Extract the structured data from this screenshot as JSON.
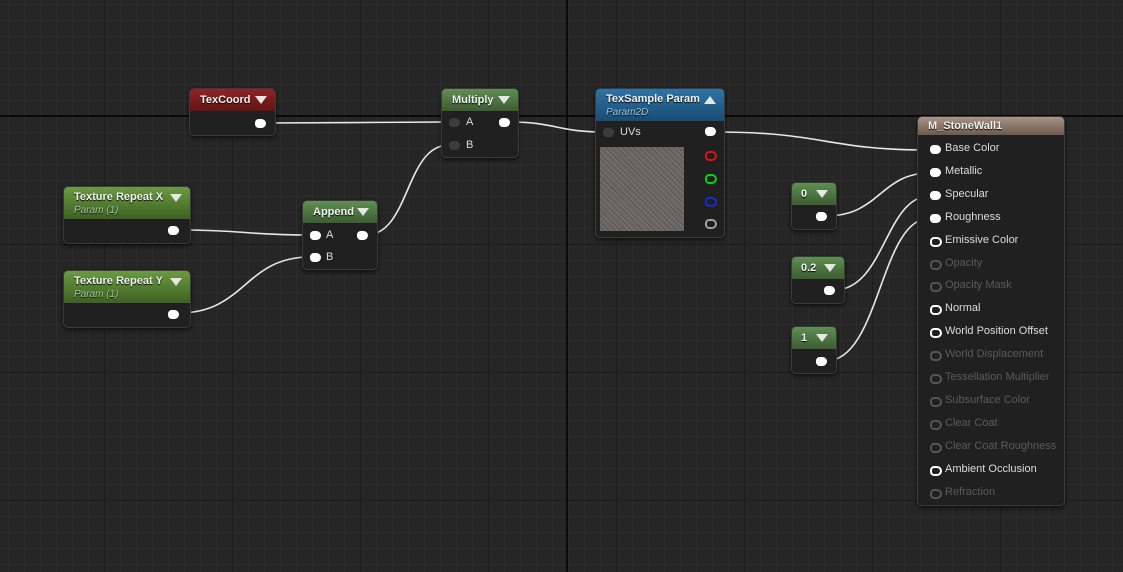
{
  "nodes": {
    "texcoord": {
      "title": "TexCoord"
    },
    "texture_repeat_x": {
      "title": "Texture Repeat X",
      "subtitle": "Param (1)"
    },
    "texture_repeat_y": {
      "title": "Texture Repeat Y",
      "subtitle": "Param (1)"
    },
    "append": {
      "title": "Append",
      "pin_a": "A",
      "pin_b": "B"
    },
    "multiply": {
      "title": "Multiply",
      "pin_a": "A",
      "pin_b": "B"
    },
    "texsample": {
      "title": "TexSample Param",
      "subtitle": "Param2D",
      "pin_uvs": "UVs"
    },
    "const_metallic": {
      "value": "0"
    },
    "const_specular": {
      "value": "0.2"
    },
    "const_roughness": {
      "value": "1"
    },
    "material": {
      "title": "M_StoneWall1",
      "inputs": [
        {
          "label": "Base Color",
          "state": "connected"
        },
        {
          "label": "Metallic",
          "state": "connected"
        },
        {
          "label": "Specular",
          "state": "connected"
        },
        {
          "label": "Roughness",
          "state": "connected"
        },
        {
          "label": "Emissive Color",
          "state": "open"
        },
        {
          "label": "Opacity",
          "state": "disabled"
        },
        {
          "label": "Opacity Mask",
          "state": "disabled"
        },
        {
          "label": "Normal",
          "state": "open"
        },
        {
          "label": "World Position Offset",
          "state": "open"
        },
        {
          "label": "World Displacement",
          "state": "disabled"
        },
        {
          "label": "Tessellation Multiplier",
          "state": "disabled"
        },
        {
          "label": "Subsurface Color",
          "state": "disabled"
        },
        {
          "label": "Clear Coat",
          "state": "disabled"
        },
        {
          "label": "Clear Coat Roughness",
          "state": "disabled"
        },
        {
          "label": "Ambient Occlusion",
          "state": "open"
        },
        {
          "label": "Refraction",
          "state": "disabled"
        }
      ]
    }
  },
  "colors": {
    "canvas": "#262626",
    "texcoord_header": "#8f2424",
    "param_header": "#6a9a42",
    "math_header": "#5f8f52",
    "texsample_header": "#2f74a6",
    "material_header": "#a99486",
    "wire": "#e8e8e8"
  }
}
